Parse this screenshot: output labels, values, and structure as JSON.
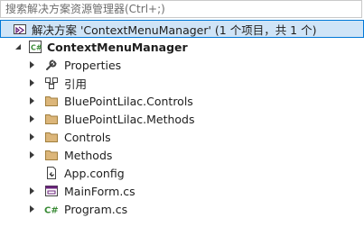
{
  "search": {
    "placeholder": "搜索解决方案资源管理器(Ctrl+;)"
  },
  "solution": {
    "label": "解决方案 'ContextMenuManager' (1 个项目，共 1 个)"
  },
  "project": {
    "label": "ContextMenuManager",
    "icon": "csharp-project-icon"
  },
  "items": [
    {
      "label": "Properties",
      "icon": "wrench-icon",
      "expandable": true
    },
    {
      "label": "引用",
      "icon": "references-icon",
      "expandable": true
    },
    {
      "label": "BluePointLilac.Controls",
      "icon": "folder-icon",
      "expandable": true
    },
    {
      "label": "BluePointLilac.Methods",
      "icon": "folder-icon",
      "expandable": true
    },
    {
      "label": "Controls",
      "icon": "folder-icon",
      "expandable": true
    },
    {
      "label": "Methods",
      "icon": "folder-icon",
      "expandable": true
    },
    {
      "label": "App.config",
      "icon": "config-file-icon",
      "expandable": false
    },
    {
      "label": "MainForm.cs",
      "icon": "form-file-icon",
      "expandable": true
    },
    {
      "label": "Program.cs",
      "icon": "csharp-file-icon",
      "expandable": true
    }
  ],
  "colors": {
    "selection_bg": "#cfe4f7",
    "selection_border": "#0078d7",
    "folder": "#dcb67a",
    "csharp": "#388a34"
  }
}
